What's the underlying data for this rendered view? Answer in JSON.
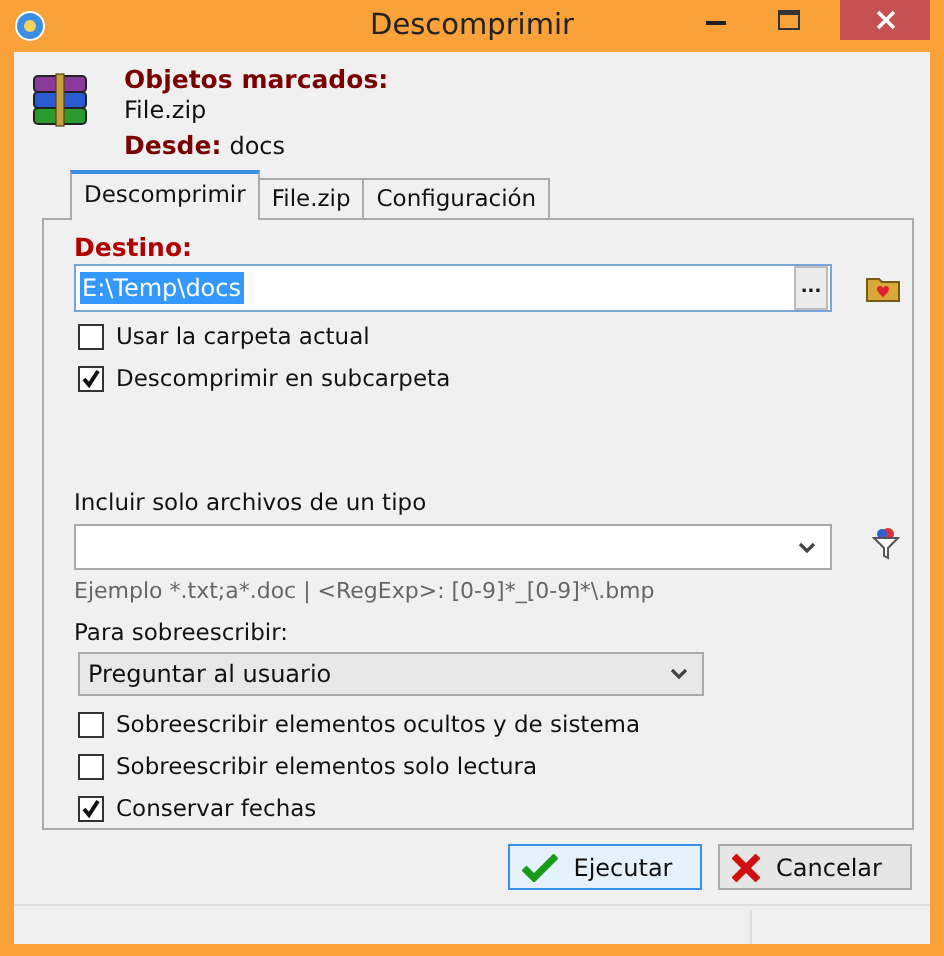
{
  "window": {
    "title": "Descomprimir"
  },
  "header": {
    "objects_label": "Objetos marcados:",
    "objects_value": "File.zip",
    "from_label": "Desde:",
    "from_value": "docs"
  },
  "tabs": [
    {
      "label": "Descomprimir",
      "selected": true
    },
    {
      "label": "File.zip",
      "selected": false
    },
    {
      "label": "Configuración",
      "selected": false
    }
  ],
  "destination": {
    "label": "Destino:",
    "value": "E:\\Temp\\docs",
    "text_selected": true,
    "browse_button": "..."
  },
  "options_top": [
    {
      "label": "Usar la carpeta actual",
      "checked": false
    },
    {
      "label": "Descomprimir en subcarpeta",
      "checked": true
    }
  ],
  "filter": {
    "label": "Incluir solo archivos de un tipo",
    "hint": "Ejemplo *.txt;a*.doc | <RegExp>: [0-9]*_[0-9]*\\.bmp"
  },
  "overwrite": {
    "label": "Para sobreescribir:",
    "value": "Preguntar al usuario"
  },
  "options_bottom": [
    {
      "label": "Sobreescribir elementos ocultos y de sistema",
      "checked": false
    },
    {
      "label": "Sobreescribir elementos solo lectura",
      "checked": false
    },
    {
      "label": "Conservar fechas",
      "checked": true
    }
  ],
  "buttons": [
    {
      "label": "Ejecutar",
      "kind": "ok",
      "focused": true
    },
    {
      "label": "Cancelar",
      "kind": "cancel",
      "focused": false
    }
  ]
}
